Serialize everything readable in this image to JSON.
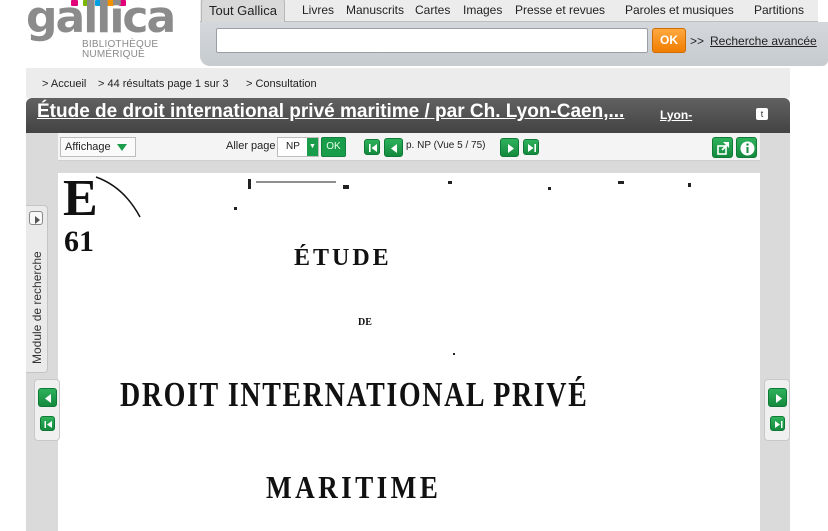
{
  "logo": {
    "word": "gallica",
    "subtitle_line1": "BIBLIOTHÈQUE",
    "subtitle_line2": "NUMÉRIQUE",
    "dot_colors": [
      "#e2007a",
      "#7ab800",
      "#00a0e3",
      "#f39200",
      "#e2007a"
    ]
  },
  "search": {
    "tabs": [
      "Tout Gallica",
      "Livres",
      "Manuscrits",
      "Cartes",
      "Images",
      "Presse et revues",
      "Paroles et musiques",
      "Partitions"
    ],
    "input_value": "",
    "ok_label": "OK",
    "advanced_prefix": ">>",
    "advanced_label": "Recherche avancée"
  },
  "breadcrumb": {
    "home": "> Accueil",
    "results": "> 44 résultats page 1 sur 3",
    "current": "> Consultation"
  },
  "document": {
    "title": "Étude de droit international privé maritime / par Ch. Lyon-Caen,...",
    "author_link": "Lyon-",
    "t_button": "t"
  },
  "toolbar": {
    "display_label": "Affichage",
    "goto_label": "Aller page",
    "page_value": "NP",
    "goto_ok": "OK",
    "page_indicator": "p. NP (Vue 5 / 75)",
    "icons": [
      "first-page-icon",
      "prev-page-icon",
      "next-page-icon",
      "last-page-icon",
      "share-icon",
      "info-icon"
    ]
  },
  "side": {
    "module_label": "Module de recherche"
  },
  "scan": {
    "stamp_letter": "E",
    "stamp_number": "61",
    "line1": "ÉTUDE",
    "line2": "DE",
    "line3": "DROIT INTERNATIONAL PRIVÉ",
    "line4": "MARITIME"
  },
  "colors": {
    "accent_green": "#1a9d4a",
    "ok_orange": "#f28a00",
    "titlebar": "#4f4f4f"
  }
}
